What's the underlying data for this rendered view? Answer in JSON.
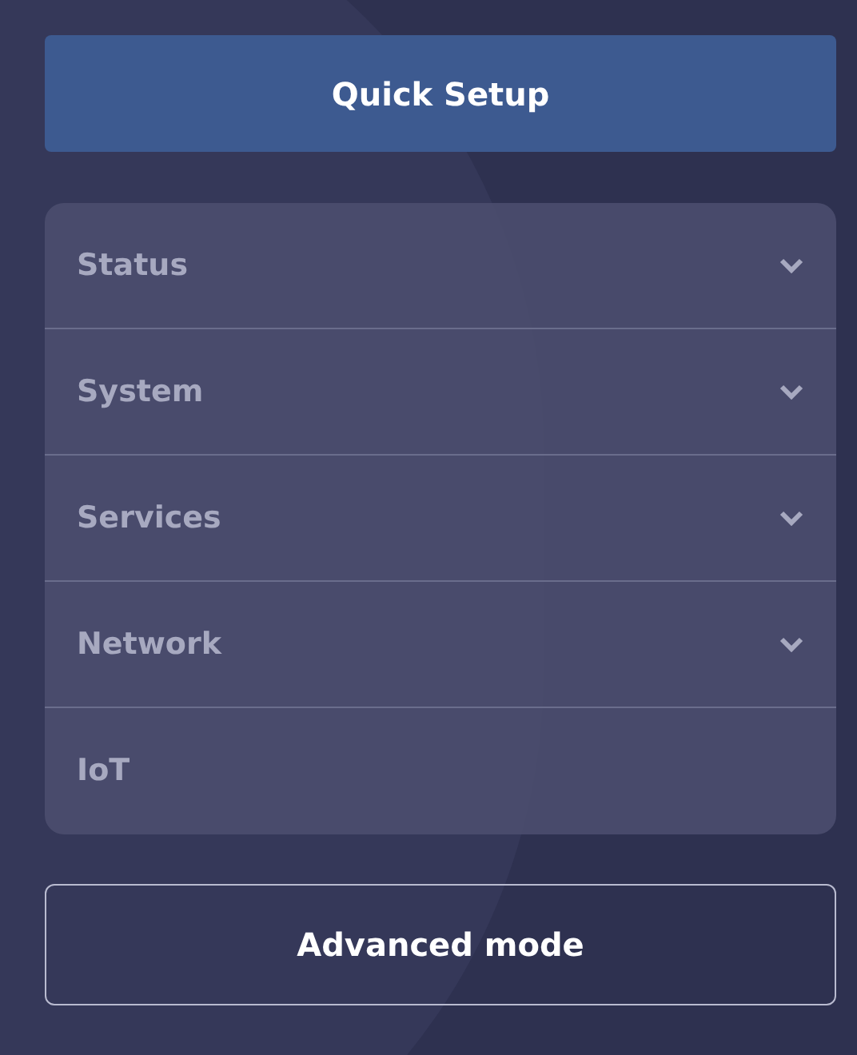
{
  "quick_setup_button": {
    "label": "Quick Setup"
  },
  "menu": {
    "items": [
      {
        "label": "Status",
        "has_submenu": true
      },
      {
        "label": "System",
        "has_submenu": true
      },
      {
        "label": "Services",
        "has_submenu": true
      },
      {
        "label": "Network",
        "has_submenu": true
      },
      {
        "label": "IoT",
        "has_submenu": false
      }
    ]
  },
  "advanced_mode_button": {
    "label": "Advanced mode"
  }
}
